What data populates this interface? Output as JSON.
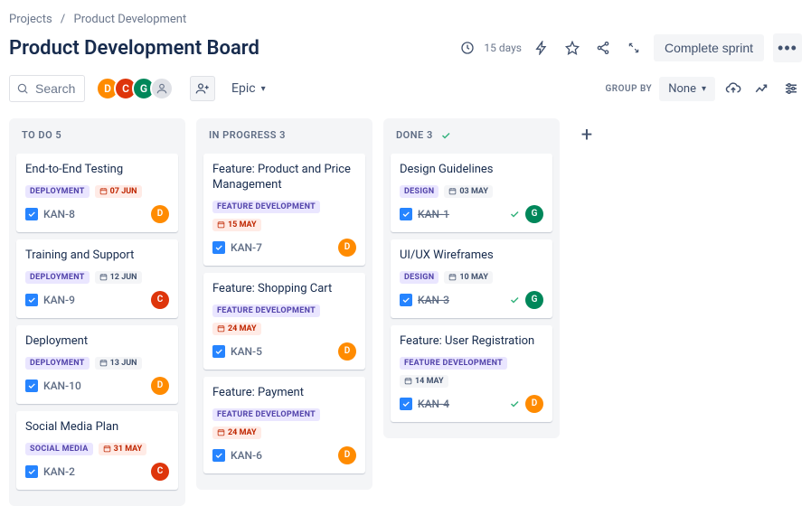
{
  "breadcrumbs": {
    "root": "Projects",
    "project": "Product Development"
  },
  "board_title": "Product Development Board",
  "header": {
    "days_text": "15 days",
    "complete_label": "Complete sprint"
  },
  "toolbar": {
    "search_placeholder": "Search",
    "epic_label": "Epic",
    "group_by_label": "GROUP BY",
    "group_by_value": "None",
    "avatars": [
      "D",
      "C",
      "G"
    ]
  },
  "columns": [
    {
      "title": "TO DO 5",
      "done": false,
      "cards": [
        {
          "title": "End-to-End Testing",
          "tag": "DEPLOYMENT",
          "tag_cls": "tag-deployment",
          "date": "07 JUN",
          "date_red": true,
          "key": "KAN-8",
          "strike": false,
          "assignee": "D",
          "av_cls": "av-D",
          "done": false
        },
        {
          "title": "Training and Support",
          "tag": "DEPLOYMENT",
          "tag_cls": "tag-deployment",
          "date": "12 JUN",
          "date_red": false,
          "key": "KAN-9",
          "strike": false,
          "assignee": "C",
          "av_cls": "av-C",
          "done": false
        },
        {
          "title": "Deployment",
          "tag": "DEPLOYMENT",
          "tag_cls": "tag-deployment",
          "date": "13 JUN",
          "date_red": false,
          "key": "KAN-10",
          "strike": false,
          "assignee": "D",
          "av_cls": "av-D",
          "done": false
        },
        {
          "title": "Social Media Plan",
          "tag": "SOCIAL MEDIA",
          "tag_cls": "tag-social",
          "date": "31 MAY",
          "date_red": true,
          "key": "KAN-2",
          "strike": false,
          "assignee": "C",
          "av_cls": "av-C",
          "done": false
        }
      ]
    },
    {
      "title": "IN PROGRESS 3",
      "done": false,
      "cards": [
        {
          "title": "Feature: Product and Price Management",
          "tag": "FEATURE DEVELOPMENT",
          "tag_cls": "tag-feature",
          "date": "15 MAY",
          "date_red": true,
          "key": "KAN-7",
          "strike": false,
          "assignee": "D",
          "av_cls": "av-D",
          "done": false
        },
        {
          "title": "Feature: Shopping Cart",
          "tag": "FEATURE DEVELOPMENT",
          "tag_cls": "tag-feature",
          "date": "24 MAY",
          "date_red": true,
          "key": "KAN-5",
          "strike": false,
          "assignee": "D",
          "av_cls": "av-D",
          "done": false
        },
        {
          "title": "Feature: Payment",
          "tag": "FEATURE DEVELOPMENT",
          "tag_cls": "tag-feature",
          "date": "24 MAY",
          "date_red": true,
          "key": "KAN-6",
          "strike": false,
          "assignee": "D",
          "av_cls": "av-D",
          "done": false
        }
      ]
    },
    {
      "title": "DONE 3",
      "done": true,
      "cards": [
        {
          "title": "Design Guidelines",
          "tag": "DESIGN",
          "tag_cls": "tag-design",
          "date": "03 MAY",
          "date_red": false,
          "key": "KAN-1",
          "strike": true,
          "assignee": "G",
          "av_cls": "av-G",
          "done": true
        },
        {
          "title": "UI/UX Wireframes",
          "tag": "DESIGN",
          "tag_cls": "tag-design",
          "date": "10 MAY",
          "date_red": false,
          "key": "KAN-3",
          "strike": true,
          "assignee": "G",
          "av_cls": "av-G",
          "done": true
        },
        {
          "title": "Feature: User Registration",
          "tag": "FEATURE DEVELOPMENT",
          "tag_cls": "tag-feature",
          "date": "14 MAY",
          "date_red": false,
          "key": "KAN-4",
          "strike": true,
          "assignee": "D",
          "av_cls": "av-D",
          "done": true
        }
      ]
    }
  ]
}
